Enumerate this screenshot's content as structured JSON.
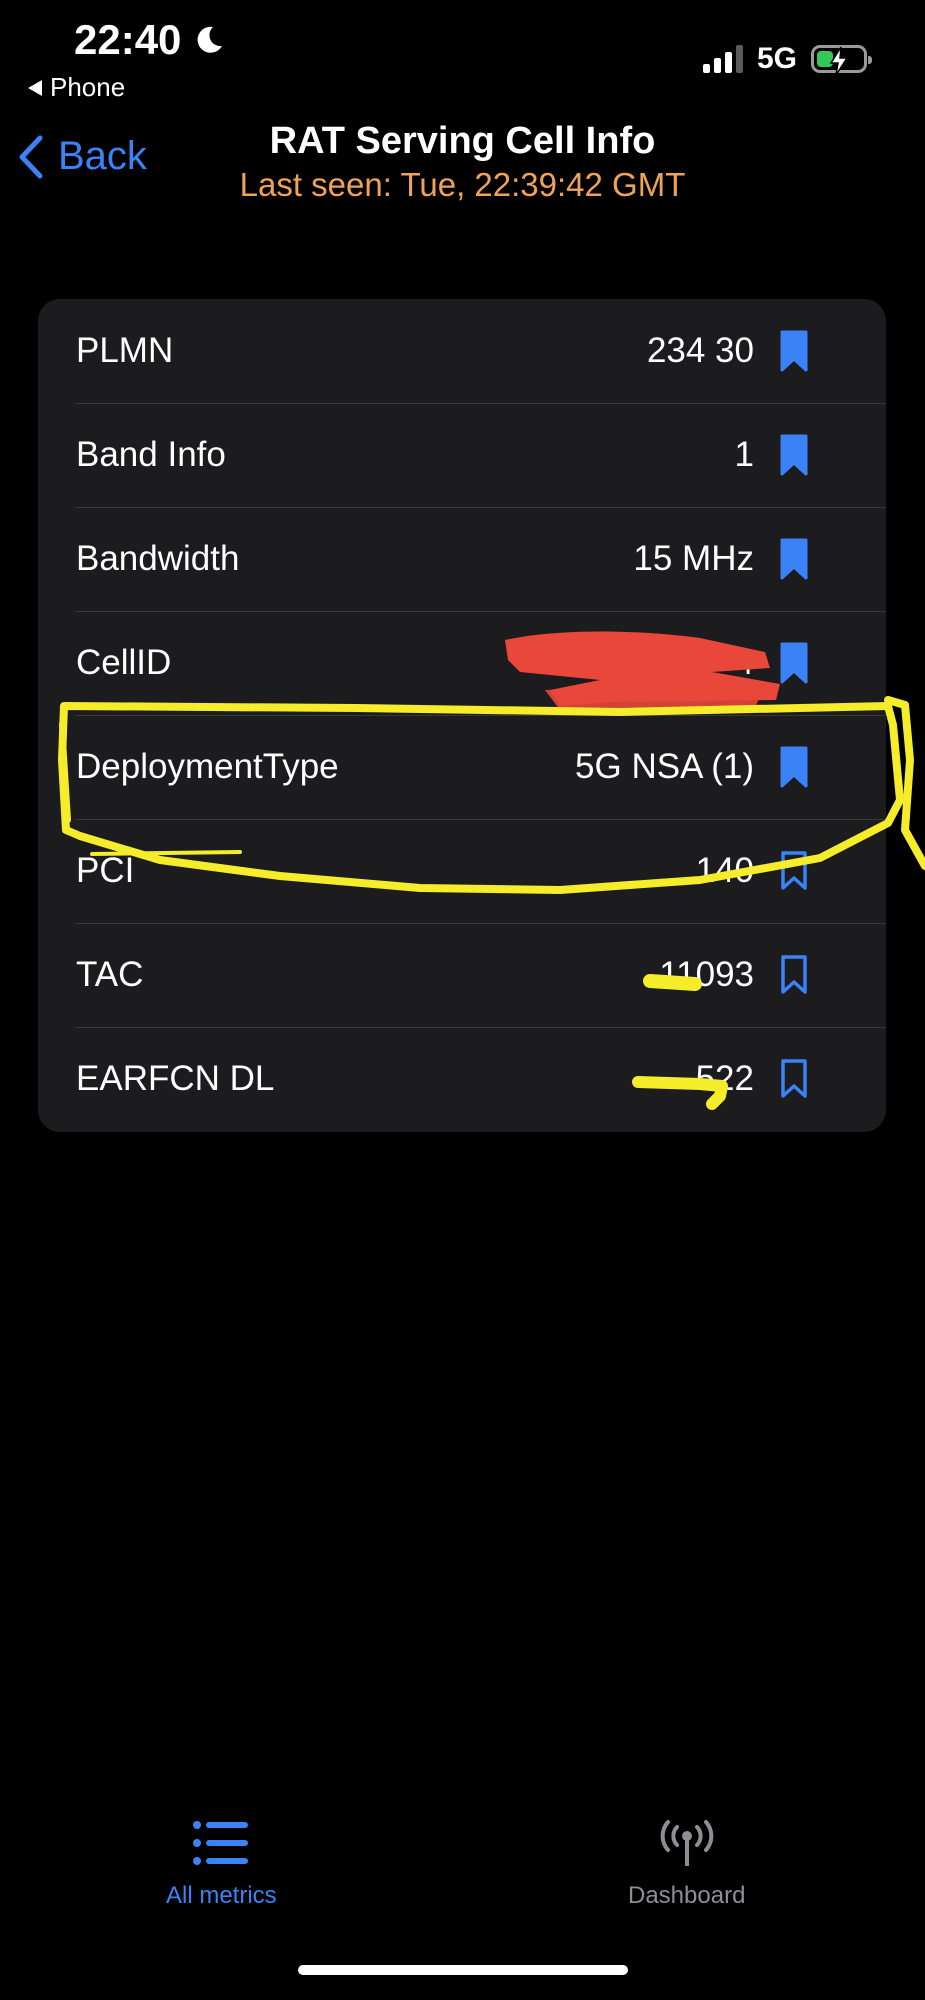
{
  "status_bar": {
    "time": "22:40",
    "back_app": "Phone",
    "network": "5G"
  },
  "nav": {
    "back_label": "Back",
    "title": "RAT Serving Cell Info",
    "subtitle": "Last seen: Tue, 22:39:42 GMT"
  },
  "rows": [
    {
      "label": "PLMN",
      "value": "234 30",
      "bookmarked": true
    },
    {
      "label": "Band Info",
      "value": "1",
      "bookmarked": true
    },
    {
      "label": "Bandwidth",
      "value": "15 MHz",
      "bookmarked": true
    },
    {
      "label": "CellID",
      "value": "4",
      "bookmarked": true
    },
    {
      "label": "DeploymentType",
      "value": "5G NSA (1)",
      "bookmarked": true
    },
    {
      "label": "PCI",
      "value": "140",
      "bookmarked": false
    },
    {
      "label": "TAC",
      "value": "11093",
      "bookmarked": false
    },
    {
      "label": "EARFCN DL",
      "value": "522",
      "bookmarked": false
    }
  ],
  "tabs": [
    {
      "label": "All metrics",
      "icon": "list-icon",
      "active": true
    },
    {
      "label": "Dashboard",
      "icon": "antenna-icon",
      "active": false
    }
  ],
  "colors": {
    "accent": "#3b82f6",
    "subtitle": "#f0a357",
    "highlight": "#f5ec2a",
    "redaction": "#e8473a"
  }
}
